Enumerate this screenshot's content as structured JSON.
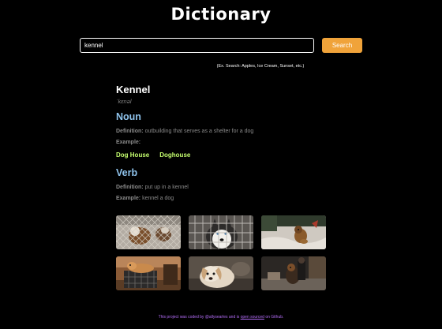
{
  "app": {
    "title": "Dictionary"
  },
  "search": {
    "value": "kennel",
    "button_label": "Search",
    "hint": "(Ex. Search: Apples, Ice Cream, Sunset, etc.)"
  },
  "entry": {
    "word": "Kennel",
    "phonetic": "ˈkɛnəl",
    "noun": {
      "heading": "Noun",
      "definition_label": "Definition:",
      "definition": "outbuilding that serves as a shelter for a dog",
      "example_label": "Example:",
      "synonyms": [
        "Dog House",
        "Doghouse"
      ]
    },
    "verb": {
      "heading": "Verb",
      "definition_label": "Definition:",
      "definition": "put up in a kennel",
      "example_label": "Example:",
      "example": "kennel a dog"
    }
  },
  "gallery": {
    "images": [
      {
        "name": "photo-dog-behind-fence"
      },
      {
        "name": "photo-husky-in-crate"
      },
      {
        "name": "photo-dog-in-snow"
      },
      {
        "name": "photo-dog-on-crate"
      },
      {
        "name": "photo-puppy-lying-down"
      },
      {
        "name": "photo-dog-with-person"
      }
    ]
  },
  "footer": {
    "prefix": "This project was coded by ",
    "author": "@allysearles",
    "middle": " and is ",
    "link_text": "open sourced",
    "suffix": " on Github."
  },
  "colors": {
    "background": "#000000",
    "accent_button": "#f0a33a",
    "pos_heading": "#8fc3ec",
    "synonym": "#c6ff6f",
    "footer": "#b26cf5"
  }
}
